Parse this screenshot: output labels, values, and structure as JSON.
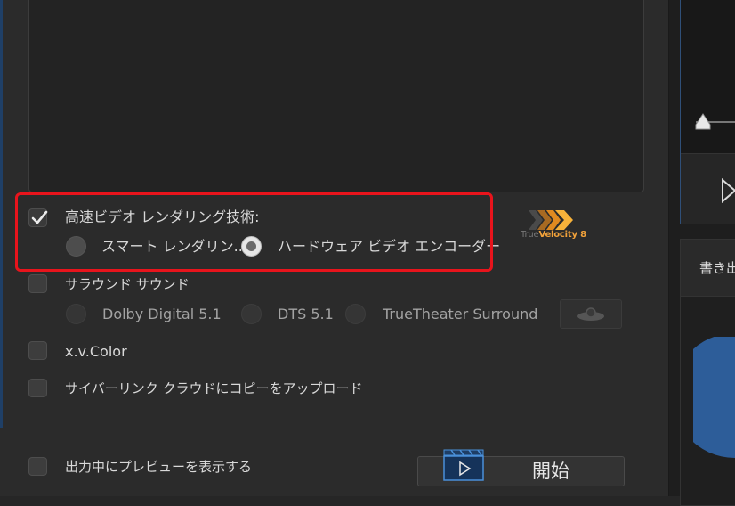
{
  "output_options": {
    "fast_rendering": {
      "label": "高速ビデオ レンダリング技術:",
      "checked": true,
      "options": [
        {
          "label": "スマート レンダリン...",
          "selected": false
        },
        {
          "label": "ハードウェア ビデオ エンコーダー",
          "selected": true
        }
      ]
    },
    "true_velocity_logo": {
      "brand": "True",
      "product": "Velocity",
      "version": "8"
    },
    "surround": {
      "label": "サラウンド サウンド",
      "checked": false,
      "options": [
        {
          "label": "Dolby Digital 5.1"
        },
        {
          "label": "DTS 5.1"
        },
        {
          "label": "TrueTheater Surround"
        }
      ]
    },
    "xvcolor": {
      "label": "x.v.Color",
      "checked": false
    },
    "cyberlink_cloud": {
      "label": "サイバーリンク クラウドにコピーをアップロード",
      "checked": false
    }
  },
  "footer": {
    "preview_during_output": {
      "label": "出力中にプレビューを表示する",
      "checked": false
    },
    "start_button": {
      "label": "開始"
    }
  },
  "right_panel": {
    "section_label": "書き出"
  },
  "colors": {
    "highlight": "#e8141c",
    "accent_blue": "#1f3f66",
    "logo_orange": "#f2a23a"
  }
}
